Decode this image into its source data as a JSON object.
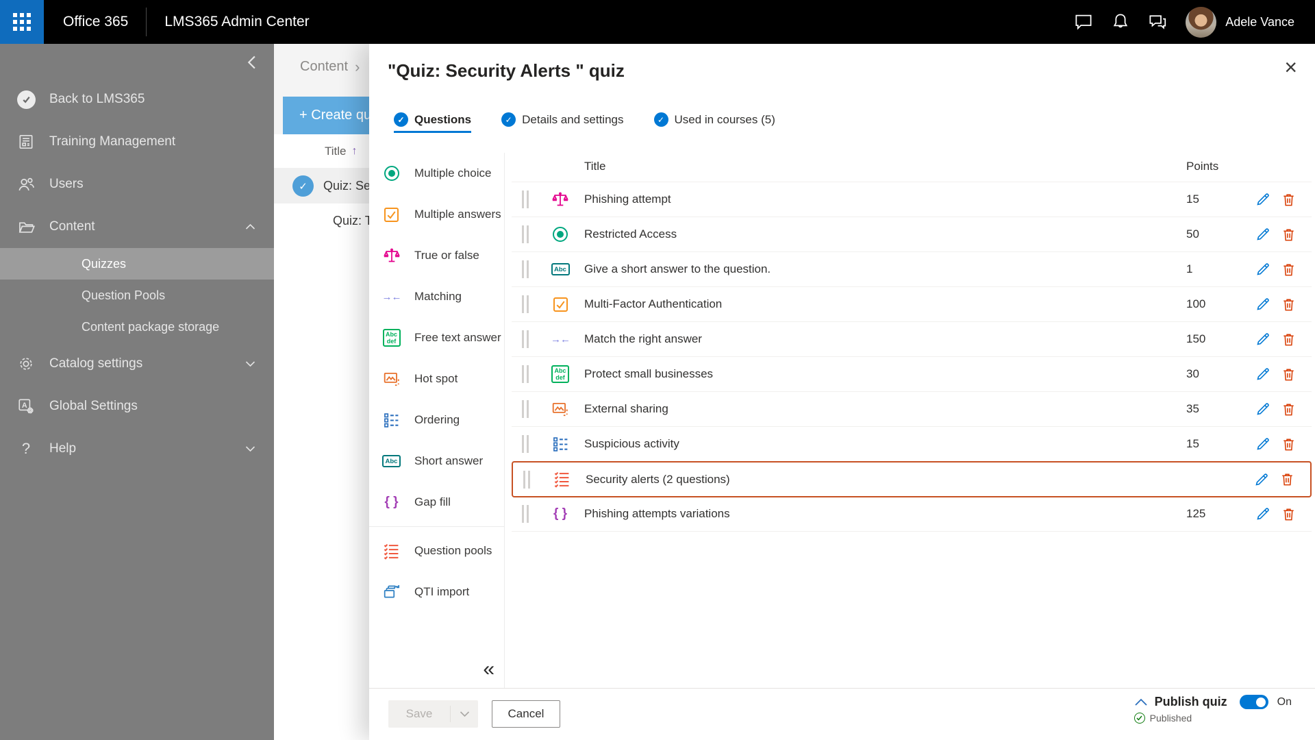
{
  "colors": {
    "accent_blue": "#0078d4",
    "highlight_orange": "#c75123",
    "waffle_blue": "#0f6cbd",
    "sidebar_gray": "#7d7d7d",
    "create_button_blue": "#5fabe0",
    "edit_pencil_blue": "#0078d4",
    "delete_trash_orange": "#d83b01",
    "published_green": "#107c10"
  },
  "icon_colors": {
    "radio": "#00a77f",
    "checkbox": "#f7941e",
    "scales": "#e3008c",
    "arrows": "#7b7fe0",
    "abcdef": "#00b15c",
    "image": "#e8722d",
    "ordered-list": "#2b6fbd",
    "abc": "#03787c",
    "braces": "#a33eb5",
    "pool-list": "#f0573d",
    "import": "#2f80c3"
  },
  "topbar": {
    "brand": "Office 365",
    "app_title": "LMS365 Admin Center",
    "user_name": "Adele Vance"
  },
  "sidebar": {
    "items": [
      {
        "label": "Back to LMS365",
        "icon": "lms-logo"
      },
      {
        "label": "Training Management",
        "icon": "document"
      },
      {
        "label": "Users",
        "icon": "people"
      },
      {
        "label": "Content",
        "icon": "folder",
        "chevron": "up",
        "subitems": [
          {
            "label": "Quizzes",
            "selected": true
          },
          {
            "label": "Question Pools"
          },
          {
            "label": "Content package storage"
          }
        ]
      },
      {
        "label": "Catalog settings",
        "icon": "gear",
        "chevron": "down"
      },
      {
        "label": "Global Settings",
        "icon": "global"
      },
      {
        "label": "Help",
        "icon": "help",
        "chevron": "down"
      }
    ]
  },
  "background": {
    "breadcrumb": "Content",
    "breadcrumb_sep": "›",
    "create_button": "+ Create qu",
    "list_header": "Title",
    "sort_glyph": "↑",
    "row_check_glyph": "✓",
    "rows": [
      "Quiz: Se",
      "Quiz: Tru"
    ]
  },
  "modal": {
    "title": "\"Quiz: Security Alerts \" quiz",
    "close_glyph": "×",
    "tab_check_glyph": "✓",
    "menu_collapse_glyph": "«",
    "tabs": [
      {
        "label": "Questions",
        "active": true
      },
      {
        "label": "Details and settings",
        "active": false
      },
      {
        "label": "Used in courses (5)",
        "active": false
      }
    ],
    "question_types": [
      {
        "label": "Multiple choice",
        "icon": "radio",
        "group": 1
      },
      {
        "label": "Multiple answers",
        "icon": "checkbox",
        "group": 1
      },
      {
        "label": "True or false",
        "icon": "scales",
        "group": 1
      },
      {
        "label": "Matching",
        "icon": "arrows",
        "group": 1
      },
      {
        "label": "Free text answer",
        "icon": "abcdef",
        "group": 1
      },
      {
        "label": "Hot spot",
        "icon": "image",
        "group": 1
      },
      {
        "label": "Ordering",
        "icon": "ordered-list",
        "group": 1
      },
      {
        "label": "Short answer",
        "icon": "abc",
        "group": 1
      },
      {
        "label": "Gap fill",
        "icon": "braces",
        "group": 1
      },
      {
        "label": "Question pools",
        "icon": "pool-list",
        "group": 2
      },
      {
        "label": "QTI import",
        "icon": "import",
        "group": 2
      }
    ],
    "table": {
      "columns": [
        "Title",
        "Points"
      ],
      "rows": [
        {
          "title": "Phishing attempt",
          "points": "15",
          "type": "scales",
          "highlighted": false
        },
        {
          "title": "Restricted Access",
          "points": "50",
          "type": "radio",
          "highlighted": false
        },
        {
          "title": "Give a short answer to the question.",
          "points": "1",
          "type": "abc",
          "highlighted": false
        },
        {
          "title": "Multi-Factor Authentication",
          "points": "100",
          "type": "checkbox",
          "highlighted": false
        },
        {
          "title": "Match the right answer",
          "points": "150",
          "type": "arrows",
          "highlighted": false
        },
        {
          "title": "Protect small businesses",
          "points": "30",
          "type": "abcdef",
          "highlighted": false
        },
        {
          "title": "External sharing",
          "points": "35",
          "type": "image",
          "highlighted": false
        },
        {
          "title": "Suspicious activity",
          "points": "15",
          "type": "ordered-list",
          "highlighted": false
        },
        {
          "title": "Security alerts (2 questions)",
          "points": "",
          "type": "pool-list",
          "highlighted": true
        },
        {
          "title": "Phishing attempts variations",
          "points": "125",
          "type": "braces",
          "highlighted": false
        }
      ]
    },
    "footer": {
      "save_label": "Save",
      "cancel_label": "Cancel",
      "publish_label": "Publish quiz",
      "toggle_state": "On",
      "status": "Published",
      "status_check_glyph": "✓"
    }
  }
}
